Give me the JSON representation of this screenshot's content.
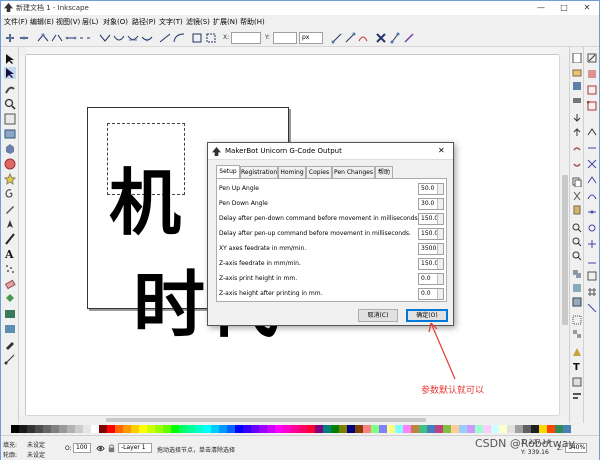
{
  "window": {
    "title": "新建文档 1 - Inkscape",
    "controls": [
      "—",
      "□",
      "✕"
    ]
  },
  "menu": [
    "文件(F)",
    "编辑(E)",
    "视图(V)",
    "层(L)",
    "对象(O)",
    "路径(P)",
    "文字(T)",
    "滤镜(S)",
    "扩展(N)",
    "帮助(H)"
  ],
  "toolbar": {
    "x_label": "X:",
    "y_label": "Y:",
    "unit": "px"
  },
  "dialog": {
    "title": "MakerBot Unicorn G-Code Output",
    "tabs": [
      "Setup",
      "Registration",
      "Homing",
      "Copies",
      "Pen Changes",
      "帮助"
    ],
    "active_tab": "Setup",
    "fields": [
      {
        "label": "Pen Up Angle",
        "value": "50.0"
      },
      {
        "label": "Pen Down Angle",
        "value": "30.0"
      },
      {
        "label": "Delay after pen-down command before movement in milliseconds.",
        "value": "150.0"
      },
      {
        "label": "Delay after pen-up command before movement in milliseconds.",
        "value": "150.0"
      },
      {
        "label": "XY axes feedrate in mm/min.",
        "value": "3500.0"
      },
      {
        "label": "Z-axis feedrate in mm/min.",
        "value": "150.0"
      },
      {
        "label": "Z-axis print height in mm.",
        "value": "0.0"
      },
      {
        "label": "Z-axis height after printing in mm.",
        "value": "0.0"
      }
    ],
    "cancel_label": "取消(C)",
    "ok_label": "确定(O)"
  },
  "canvas": {
    "char1": "机",
    "char2": "时代"
  },
  "annotation": "参数默认就可以",
  "status": {
    "fill_label": "填充:",
    "fill_value": "未设定",
    "stroke_label": "轮廓:",
    "stroke_value": "未设定",
    "opacity_label": "O:",
    "opacity_value": "100",
    "layer": "-Layer 1",
    "message": "拖动选择节点，单击清除选择",
    "coords": "X: 227.14",
    "coords_y": "Y: 339.16",
    "zoom_label": "Z:",
    "zoom": "140%"
  },
  "watermark": "CSDN @Robotway",
  "colors": {
    "accent": "#0078d7",
    "annotation": "#e53935",
    "palette": [
      "#000000",
      "#1a1a1a",
      "#333333",
      "#4d4d4d",
      "#666666",
      "#808080",
      "#999999",
      "#b3b3b3",
      "#cccccc",
      "#e6e6e6",
      "#ffffff",
      "#800000",
      "#ff0000",
      "#ff6600",
      "#ff9900",
      "#ffcc00",
      "#ffff00",
      "#ccff00",
      "#99ff00",
      "#66ff00",
      "#00ff00",
      "#00ff66",
      "#00ff99",
      "#00ffcc",
      "#00ffff",
      "#00ccff",
      "#0099ff",
      "#0066ff",
      "#0000ff",
      "#3300ff",
      "#6600ff",
      "#9900ff",
      "#cc00ff",
      "#ff00ff",
      "#ff00cc",
      "#ff0099",
      "#ff0066",
      "#ff0033",
      "#800080",
      "#008080",
      "#008000",
      "#808000",
      "#000080",
      "#804000",
      "#ff8080",
      "#80ff80",
      "#8080ff",
      "#ffff80",
      "#80ffff",
      "#ff80ff",
      "#c08040",
      "#40c080",
      "#4080c0",
      "#c04080",
      "#80c040",
      "#ffcc99",
      "#99ccff",
      "#cc99ff",
      "#99ffcc",
      "#ffccff",
      "#ccffff",
      "#ffffcc",
      "#e0e0e0",
      "#a0a0a0",
      "#606060",
      "#202020",
      "#ffd700",
      "#ff4500",
      "#2e8b57",
      "#4682b4"
    ]
  }
}
